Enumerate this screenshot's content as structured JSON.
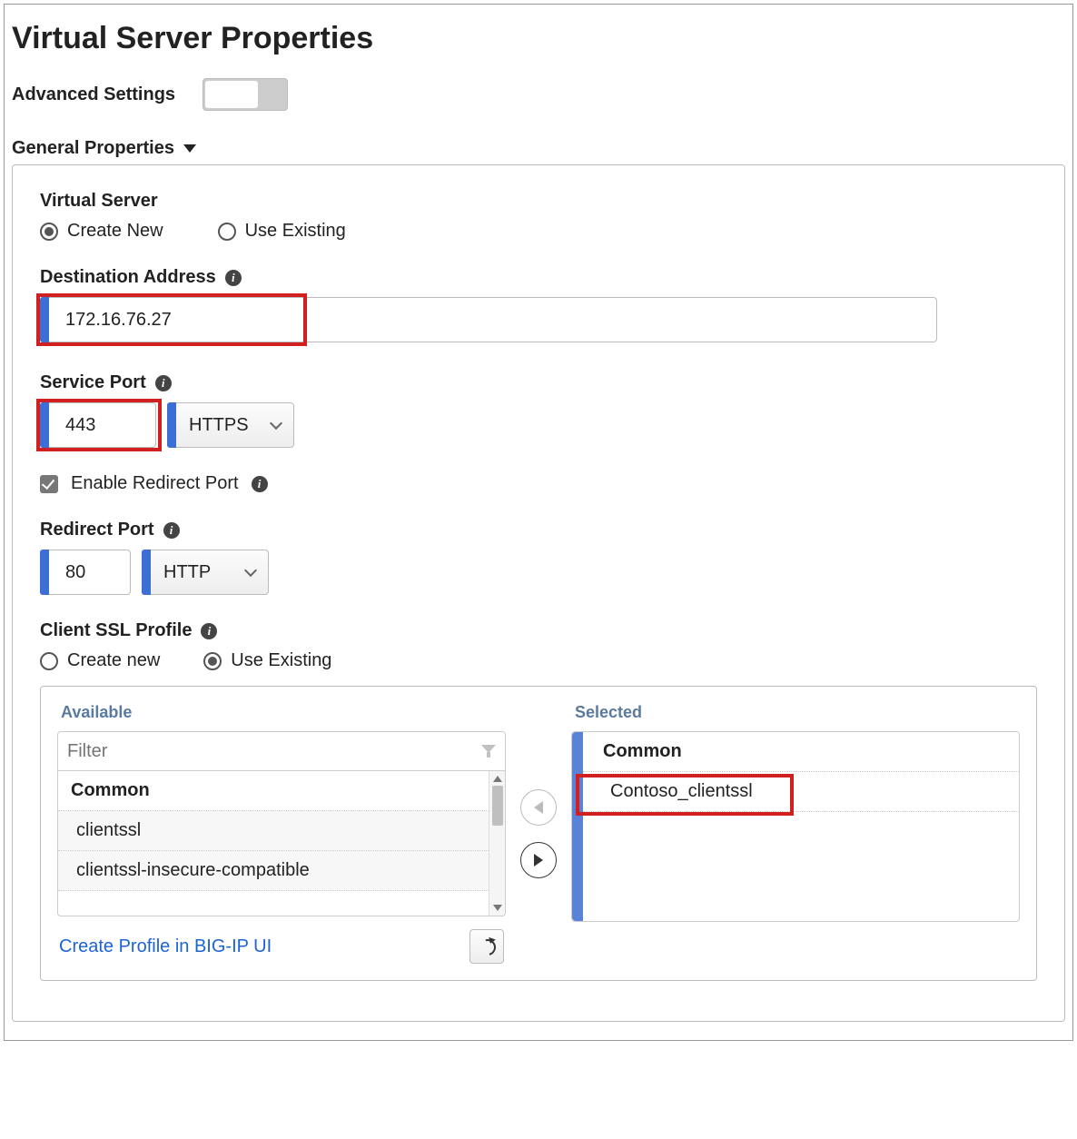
{
  "page": {
    "title": "Virtual Server Properties",
    "advanced_settings_label": "Advanced Settings"
  },
  "section": {
    "header": "General Properties"
  },
  "vs_mode": {
    "label": "Virtual Server",
    "create_new": "Create New",
    "use_existing": "Use Existing"
  },
  "dest": {
    "label": "Destination Address",
    "value": "172.16.76.27"
  },
  "service_port": {
    "label": "Service Port",
    "value": "443",
    "protocol": "HTTPS"
  },
  "redirect_enable": {
    "label": "Enable Redirect Port"
  },
  "redirect_port": {
    "label": "Redirect Port",
    "value": "80",
    "protocol": "HTTP"
  },
  "client_ssl": {
    "label": "Client SSL Profile",
    "create_new": "Create new",
    "use_existing": "Use Existing"
  },
  "dual": {
    "available_title": "Available",
    "selected_title": "Selected",
    "filter_placeholder": "Filter",
    "group_header": "Common",
    "available_items": [
      "clientssl",
      "clientssl-insecure-compatible"
    ],
    "selected_group": "Common",
    "selected_item": "Contoso_clientssl",
    "create_link": "Create Profile in BIG-IP UI"
  }
}
